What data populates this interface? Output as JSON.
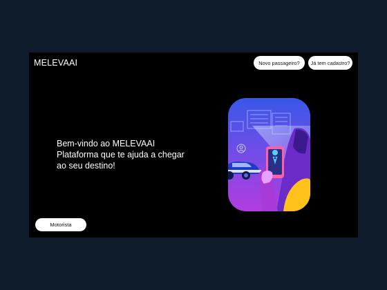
{
  "header": {
    "brand": "MELEVAAI",
    "passenger_button": "Novo passageiro?",
    "login_button": "Já tem cadastro?"
  },
  "hero": {
    "line1": "Bem-vindo ao MELEVAAI",
    "line2": "Plataforma que te ajuda a chegar",
    "line3": "ao seu destino!"
  },
  "footer": {
    "driver_button": "Motorista"
  },
  "colors": {
    "background": "#0d1b2a",
    "frame": "#000000",
    "gradient_top": "#3a57e8",
    "gradient_bottom": "#b43ce0",
    "accent_yellow": "#ffc21a"
  },
  "icons": [
    "user-icon",
    "location-pin-icon"
  ]
}
